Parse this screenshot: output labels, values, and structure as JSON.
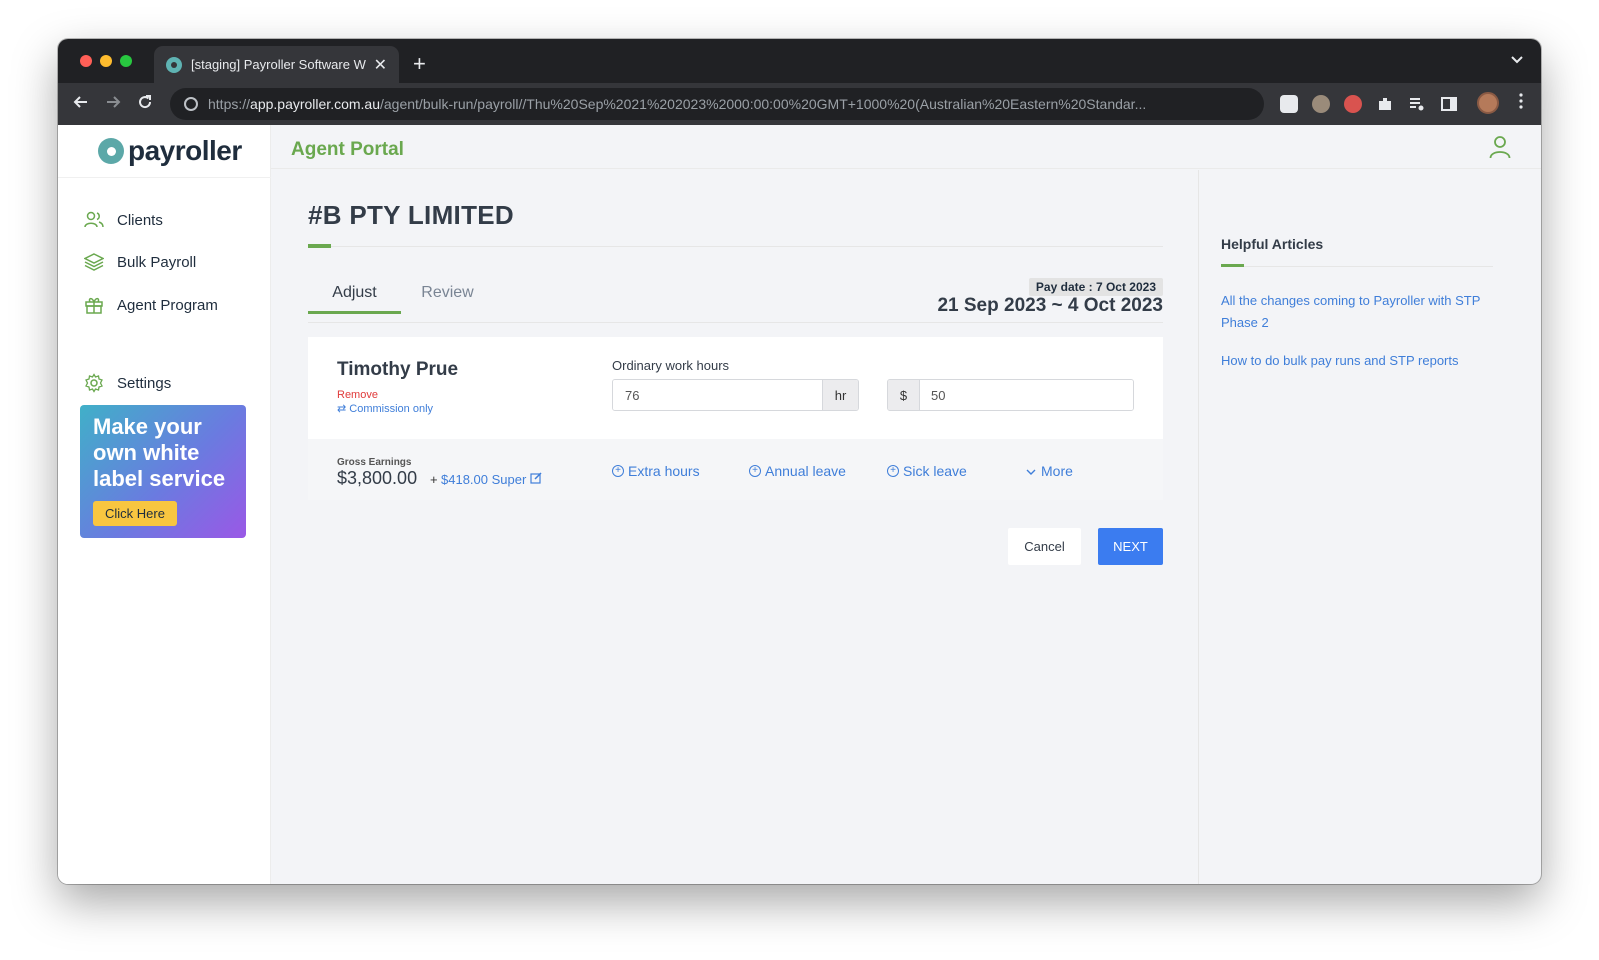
{
  "browser": {
    "tab_title": "[staging] Payroller Software W",
    "tab_close": "✕",
    "new_tab": "+",
    "url_scheme": "https://",
    "url_host": "app.payroller.com.au",
    "url_path": "/agent/bulk-run/payroll//Thu%20Sep%2021%202023%2000:00:00%20GMT+1000%20(Australian%20Eastern%20Standar..."
  },
  "sidebar": {
    "logo_text": "payroller",
    "items": [
      {
        "label": "Clients",
        "icon": "users-icon"
      },
      {
        "label": "Bulk Payroll",
        "icon": "layers-icon"
      },
      {
        "label": "Agent Program",
        "icon": "gift-icon"
      },
      {
        "label": "Settings",
        "icon": "gear-icon"
      }
    ],
    "promo": {
      "text": "Make your own white label service",
      "button": "Click Here"
    }
  },
  "header": {
    "portal_title": "Agent Portal"
  },
  "main": {
    "company": "#B PTY LIMITED",
    "tabs": [
      "Adjust",
      "Review"
    ],
    "active_tab": "Adjust",
    "pay_date": "Pay date : 7 Oct 2023",
    "period": "21 Sep 2023 ~ 4 Oct 2023",
    "employee": {
      "name": "Timothy Prue",
      "remove": "Remove",
      "commission": "Commission only",
      "hours_label": "Ordinary work hours",
      "hours_value": "76",
      "hours_unit": "hr",
      "rate_prefix": "$",
      "rate_value": "50",
      "gross_label": "Gross Earnings",
      "gross_amount": "$3,800.00",
      "super_plus": "+",
      "super": "$418.00 Super",
      "actions": [
        "Extra hours",
        "Annual leave",
        "Sick leave",
        "More"
      ]
    },
    "cancel": "Cancel",
    "next": "NEXT"
  },
  "help": {
    "title": "Helpful Articles",
    "articles": [
      "All the changes coming to Payroller with STP Phase 2",
      "How to do bulk pay runs and STP reports"
    ]
  },
  "colors": {
    "brand_green": "#6aa84f",
    "link_blue": "#3f7ed9",
    "primary_button": "#3b7cf0",
    "danger": "#e03a3a"
  }
}
